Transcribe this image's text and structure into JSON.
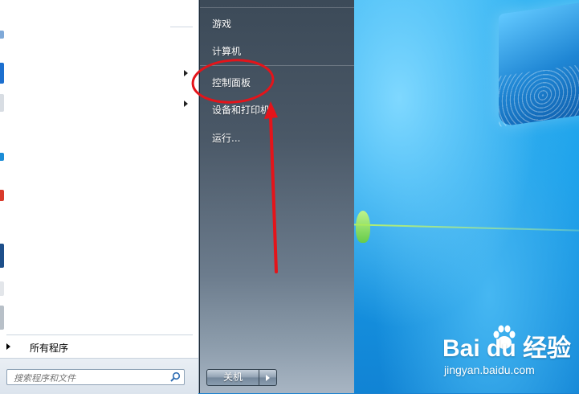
{
  "right_pane": {
    "items": [
      {
        "label": "游戏"
      },
      {
        "label": "计算机"
      },
      {
        "label": "控制面板"
      },
      {
        "label": "设备和打印机"
      },
      {
        "label": "运行..."
      }
    ],
    "shutdown_label": "关机"
  },
  "left_pane": {
    "all_programs_label": "所有程序",
    "search_placeholder": "搜索程序和文件"
  },
  "watermark": {
    "brand": "Bai du 经验",
    "url": "jingyan.baidu.com"
  },
  "annotation": {
    "circle_color": "#e4141a",
    "arrow_color": "#e4141a"
  },
  "icons": [
    "search-icon",
    "chevron-right-icon",
    "windows-logo",
    "baidu-paw-icon"
  ]
}
